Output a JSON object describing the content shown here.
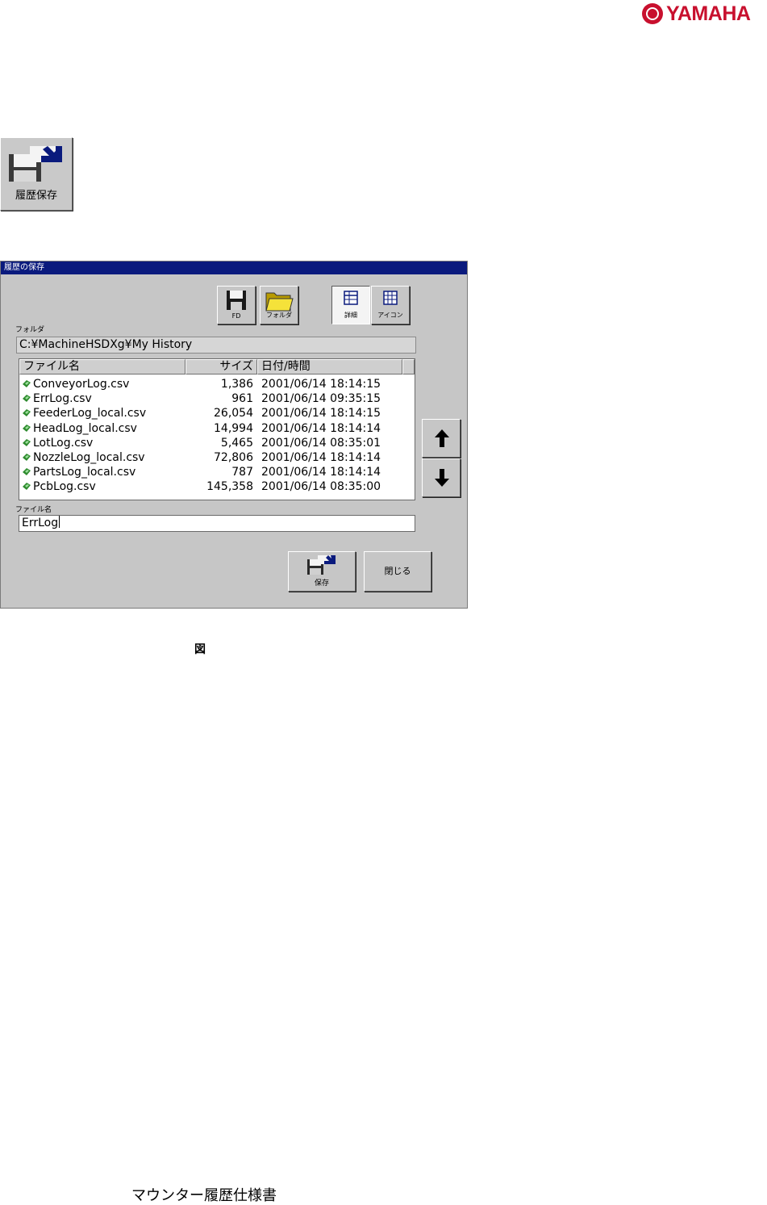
{
  "brand": {
    "name": "YAMAHA",
    "color": "#c8102e"
  },
  "history_save_button": {
    "label": "履歴保存",
    "icon": "save-to-disk-icon"
  },
  "dialog": {
    "title": "履歴の保存",
    "toolbar": {
      "fd_label": "FD",
      "folder_label": "フォルダ",
      "detail_label": "詳細",
      "icon_label": "アイコン",
      "detail_selected": true
    },
    "folder_label": "フォルダ",
    "folder_path": "C:¥MachineHSDXg¥My History",
    "columns": {
      "name": "ファイル名",
      "size": "サイズ",
      "datetime": "日付/時間"
    },
    "files": [
      {
        "name": "ConveyorLog.csv",
        "size": "1,386",
        "datetime": "2001/06/14 18:14:15"
      },
      {
        "name": "ErrLog.csv",
        "size": "961",
        "datetime": "2001/06/14 09:35:15"
      },
      {
        "name": "FeederLog_local.csv",
        "size": "26,054",
        "datetime": "2001/06/14 18:14:15"
      },
      {
        "name": "HeadLog_local.csv",
        "size": "14,994",
        "datetime": "2001/06/14 18:14:14"
      },
      {
        "name": "LotLog.csv",
        "size": "5,465",
        "datetime": "2001/06/14 08:35:01"
      },
      {
        "name": "NozzleLog_local.csv",
        "size": "72,806",
        "datetime": "2001/06/14 18:14:14"
      },
      {
        "name": "PartsLog_local.csv",
        "size": "787",
        "datetime": "2001/06/14 18:14:14"
      },
      {
        "name": "PcbLog.csv",
        "size": "145,358",
        "datetime": "2001/06/14 08:35:00"
      }
    ],
    "filename_label": "ファイル名",
    "filename_value": "ErrLog",
    "save_label": "保存",
    "close_label": "閉じる",
    "colors": {
      "titlebar": "#0a1a7d",
      "face": "#c6c6c6"
    }
  },
  "figure_label": "図",
  "footer": "マウンター履歴仕様書"
}
